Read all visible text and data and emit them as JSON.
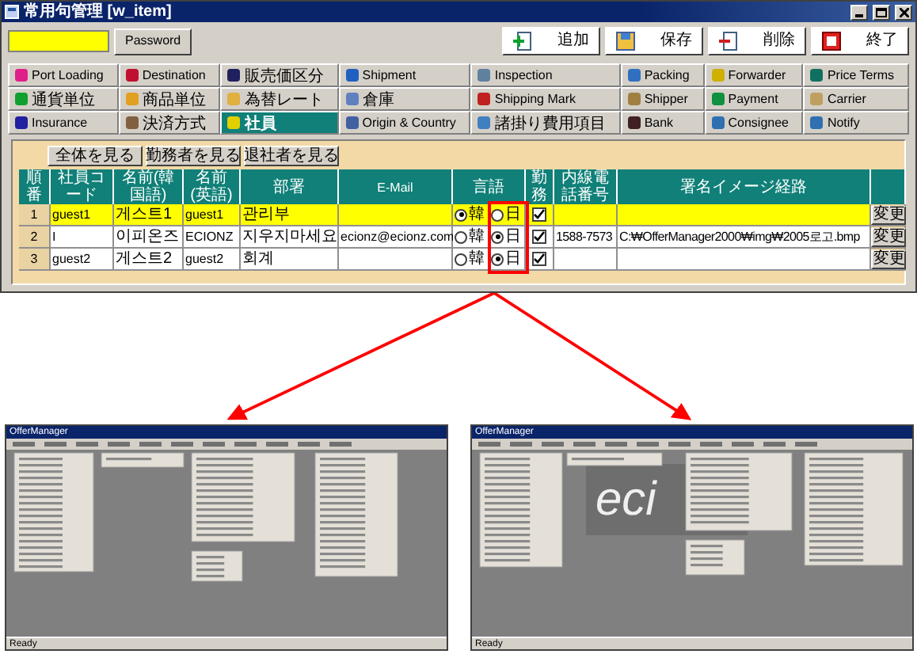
{
  "window": {
    "title": "常用句管理 [w_item]"
  },
  "login": {
    "button": "Password"
  },
  "toolbar": [
    {
      "label": "追加"
    },
    {
      "label": "保存"
    },
    {
      "label": "削除"
    },
    {
      "label": "終了"
    }
  ],
  "tabs": [
    {
      "label": "Port Loading",
      "selected": false
    },
    {
      "label": "Destination",
      "selected": false
    },
    {
      "label": "販売価区分",
      "selected": false
    },
    {
      "label": "Shipment",
      "selected": false
    },
    {
      "label": "Inspection",
      "selected": false
    },
    {
      "label": "Packing",
      "selected": false
    },
    {
      "label": "Forwarder",
      "selected": false
    },
    {
      "label": "Price Terms",
      "selected": false
    },
    {
      "label": "通貨単位",
      "selected": false
    },
    {
      "label": "商品単位",
      "selected": false
    },
    {
      "label": "為替レート",
      "selected": false
    },
    {
      "label": "倉庫",
      "selected": false
    },
    {
      "label": "Shipping Mark",
      "selected": false
    },
    {
      "label": "Shipper",
      "selected": false
    },
    {
      "label": "Payment",
      "selected": false
    },
    {
      "label": "Carrier",
      "selected": false
    },
    {
      "label": "Insurance",
      "selected": false
    },
    {
      "label": "決済方式",
      "selected": false
    },
    {
      "label": "社員",
      "selected": true
    },
    {
      "label": "Origin & Country",
      "selected": false
    },
    {
      "label": "諸掛り費用項目",
      "selected": false
    },
    {
      "label": "Bank",
      "selected": false
    },
    {
      "label": "Consignee",
      "selected": false
    },
    {
      "label": "Notify",
      "selected": false
    }
  ],
  "staff": {
    "filters": [
      "全体を見る",
      "勤務者を見る",
      "退社者を見る"
    ],
    "columns": [
      "順番",
      "社員コード",
      "名前(韓国語)",
      "名前(英語)",
      "部署",
      "E-Mail",
      "言語",
      "勤務",
      "内線電話番号",
      "署名イメージ経路"
    ],
    "rows": [
      {
        "selected": true,
        "no": "1",
        "code": "guest1",
        "name_ko": "게스트1",
        "name_en": "guest1",
        "dept": "관리부",
        "languages": [
          {
            "label": "韓",
            "selected": true
          },
          {
            "label": "日",
            "selected": false
          }
        ],
        "working": true,
        "edit": "変更"
      },
      {
        "selected": false,
        "no": "2",
        "code": "I",
        "name_ko": "이피온즈",
        "name_en": "ECIONZ",
        "dept": "지우지마세요",
        "email": "ecionz@ecionz.com",
        "languages": [
          {
            "label": "韓",
            "selected": false
          },
          {
            "label": "日",
            "selected": true
          }
        ],
        "working": true,
        "extension": "1588-7573",
        "signature_path": "C:₩OfferManager2000₩img₩2005로고.bmp",
        "edit": "変更"
      },
      {
        "selected": false,
        "no": "3",
        "code": "guest2",
        "name_ko": "게스트2",
        "name_en": "guest2",
        "dept": "회계",
        "languages": [
          {
            "label": "韓",
            "selected": false
          },
          {
            "label": "日",
            "selected": true
          }
        ],
        "working": true,
        "edit": "変更"
      }
    ]
  },
  "screenshots": [
    {
      "title": "OfferManager",
      "status": "Ready"
    },
    {
      "title": "OfferManager",
      "logo": "eci",
      "status": "Ready"
    }
  ]
}
